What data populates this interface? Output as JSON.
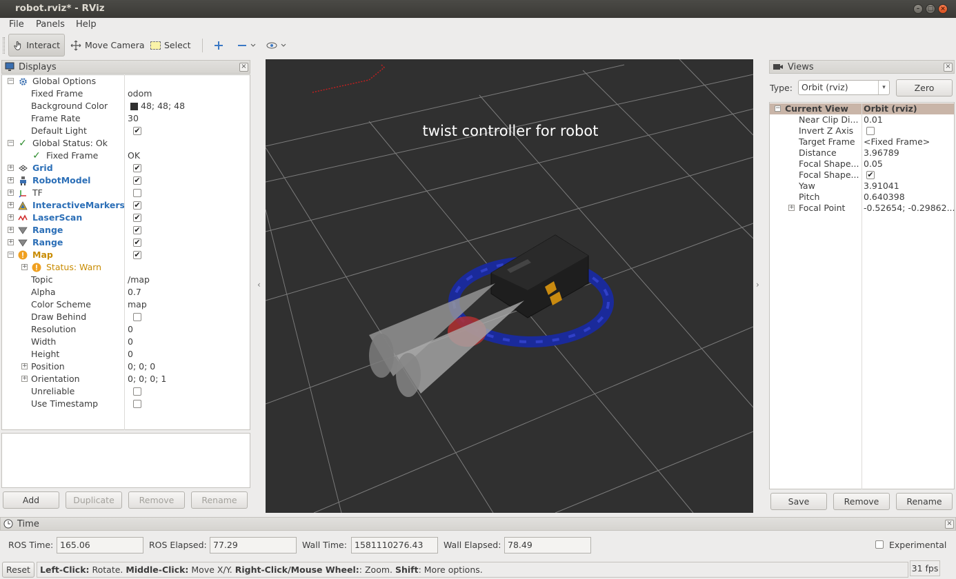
{
  "window": {
    "title": "robot.rviz* - RViz"
  },
  "menu": {
    "file": "File",
    "panels": "Panels",
    "help": "Help"
  },
  "toolbar": {
    "interact": "Interact",
    "move_camera": "Move Camera",
    "select": "Select"
  },
  "displays": {
    "title": "Displays",
    "rows": [
      {
        "label": "Global Options",
        "value": ""
      },
      {
        "label": "Fixed Frame",
        "value": "odom"
      },
      {
        "label": "Background Color",
        "value": "48; 48; 48"
      },
      {
        "label": "Frame Rate",
        "value": "30"
      },
      {
        "label": "Default Light",
        "value": ""
      },
      {
        "label": "Global Status: Ok",
        "value": ""
      },
      {
        "label": "Fixed Frame",
        "value": "OK"
      },
      {
        "label": "Grid",
        "value": ""
      },
      {
        "label": "RobotModel",
        "value": ""
      },
      {
        "label": "TF",
        "value": ""
      },
      {
        "label": "InteractiveMarkers",
        "value": ""
      },
      {
        "label": "LaserScan",
        "value": ""
      },
      {
        "label": "Range",
        "value": ""
      },
      {
        "label": "Range",
        "value": ""
      },
      {
        "label": "Map",
        "value": ""
      },
      {
        "label": "Status: Warn",
        "value": ""
      },
      {
        "label": "Topic",
        "value": "/map"
      },
      {
        "label": "Alpha",
        "value": "0.7"
      },
      {
        "label": "Color Scheme",
        "value": "map"
      },
      {
        "label": "Draw Behind",
        "value": ""
      },
      {
        "label": "Resolution",
        "value": "0"
      },
      {
        "label": "Width",
        "value": "0"
      },
      {
        "label": "Height",
        "value": "0"
      },
      {
        "label": "Position",
        "value": "0; 0; 0"
      },
      {
        "label": "Orientation",
        "value": "0; 0; 0; 1"
      },
      {
        "label": "Unreliable",
        "value": ""
      },
      {
        "label": "Use Timestamp",
        "value": ""
      }
    ],
    "buttons": {
      "add": "Add",
      "duplicate": "Duplicate",
      "remove": "Remove",
      "rename": "Rename"
    }
  },
  "viewport": {
    "overlay_text": "twist  controller  for  robot"
  },
  "views": {
    "title": "Views",
    "type_label": "Type:",
    "type_value": "Orbit (rviz)",
    "zero": "Zero",
    "header": {
      "label": "Current View",
      "value": "Orbit (rviz)"
    },
    "rows": [
      {
        "label": "Near Clip Di...",
        "value": "0.01"
      },
      {
        "label": "Invert Z Axis",
        "value": ""
      },
      {
        "label": "Target Frame",
        "value": "<Fixed Frame>"
      },
      {
        "label": "Distance",
        "value": "3.96789"
      },
      {
        "label": "Focal Shape...",
        "value": "0.05"
      },
      {
        "label": "Focal Shape...",
        "value": ""
      },
      {
        "label": "Yaw",
        "value": "3.91041"
      },
      {
        "label": "Pitch",
        "value": "0.640398"
      },
      {
        "label": "Focal Point",
        "value": "-0.52654; -0.29862..."
      }
    ],
    "buttons": {
      "save": "Save",
      "remove": "Remove",
      "rename": "Rename"
    }
  },
  "time": {
    "title": "Time",
    "ros_time_label": "ROS Time:",
    "ros_time": "165.06",
    "ros_elapsed_label": "ROS Elapsed:",
    "ros_elapsed": "77.29",
    "wall_time_label": "Wall Time:",
    "wall_time": "1581110276.43",
    "wall_elapsed_label": "Wall Elapsed:",
    "wall_elapsed": "78.49",
    "experimental": "Experimental"
  },
  "status": {
    "reset": "Reset",
    "hint_b1": "Left-Click:",
    "hint_t1": " Rotate. ",
    "hint_b2": "Middle-Click:",
    "hint_t2": " Move X/Y. ",
    "hint_b3": "Right-Click/Mouse Wheel:",
    "hint_t3": ": Zoom. ",
    "hint_b4": "Shift",
    "hint_t4": ": More options.",
    "fps": "31 fps"
  },
  "colors": {
    "background_swatch": "#303030",
    "viewport_bg": "#303030",
    "warn": "#c88b00",
    "link": "#2c6fb7"
  }
}
